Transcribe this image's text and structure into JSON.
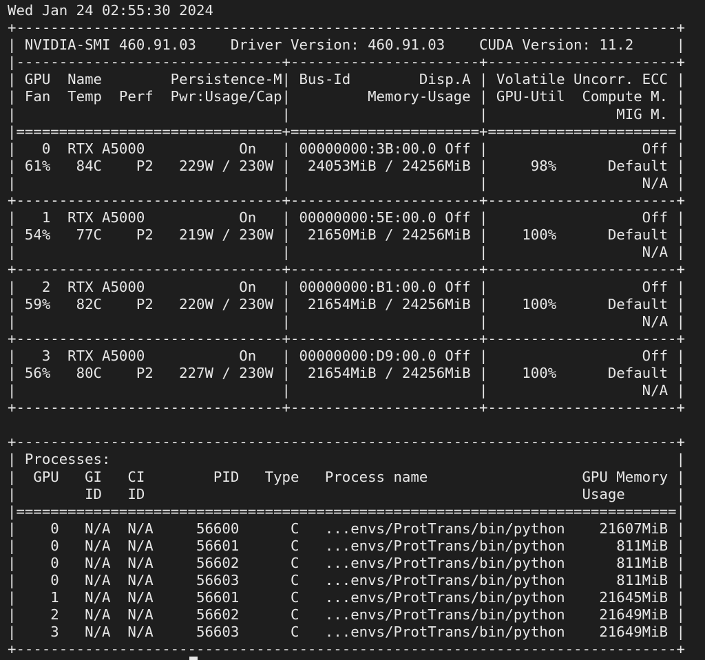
{
  "terminal": {
    "lines": [
      "Wed Jan 24 02:55:30 2024",
      "+-----------------------------------------------------------------------------+",
      "| NVIDIA-SMI 460.91.03    Driver Version: 460.91.03    CUDA Version: 11.2     |",
      "|-------------------------------+----------------------+----------------------+",
      "| GPU  Name        Persistence-M| Bus-Id        Disp.A | Volatile Uncorr. ECC |",
      "| Fan  Temp  Perf  Pwr:Usage/Cap|         Memory-Usage | GPU-Util  Compute M. |",
      "|                               |                      |               MIG M. |",
      "|===============================+======================+======================|",
      "|   0  RTX A5000           On   | 00000000:3B:00.0 Off |                  Off |",
      "| 61%   84C    P2   229W / 230W |  24053MiB / 24256MiB |     98%      Default |",
      "|                               |                      |                  N/A |",
      "+-------------------------------+----------------------+----------------------+",
      "|   1  RTX A5000           On   | 00000000:5E:00.0 Off |                  Off |",
      "| 54%   77C    P2   219W / 230W |  21650MiB / 24256MiB |    100%      Default |",
      "|                               |                      |                  N/A |",
      "+-------------------------------+----------------------+----------------------+",
      "|   2  RTX A5000           On   | 00000000:B1:00.0 Off |                  Off |",
      "| 59%   82C    P2   220W / 230W |  21654MiB / 24256MiB |    100%      Default |",
      "|                               |                      |                  N/A |",
      "+-------------------------------+----------------------+----------------------+",
      "|   3  RTX A5000           On   | 00000000:D9:00.0 Off |                  Off |",
      "| 56%   80C    P2   227W / 230W |  21654MiB / 24256MiB |    100%      Default |",
      "|                               |                      |                  N/A |",
      "+-------------------------------+----------------------+----------------------+",
      "",
      "+-----------------------------------------------------------------------------+",
      "| Processes:                                                                  |",
      "|  GPU   GI   CI        PID   Type   Process name                  GPU Memory |",
      "|        ID   ID                                                   Usage      |",
      "|=============================================================================|",
      "|    0   N/A  N/A     56600      C   ...envs/ProtTrans/bin/python    21607MiB |",
      "|    0   N/A  N/A     56601      C   ...envs/ProtTrans/bin/python      811MiB |",
      "|    0   N/A  N/A     56602      C   ...envs/ProtTrans/bin/python      811MiB |",
      "|    0   N/A  N/A     56603      C   ...envs/ProtTrans/bin/python      811MiB |",
      "|    1   N/A  N/A     56601      C   ...envs/ProtTrans/bin/python    21645MiB |",
      "|    2   N/A  N/A     56602      C   ...envs/ProtTrans/bin/python    21649MiB |",
      "|    3   N/A  N/A     56603      C   ...envs/ProtTrans/bin/python    21649MiB |",
      "+-----------------------------------------------------------------------------+"
    ]
  }
}
